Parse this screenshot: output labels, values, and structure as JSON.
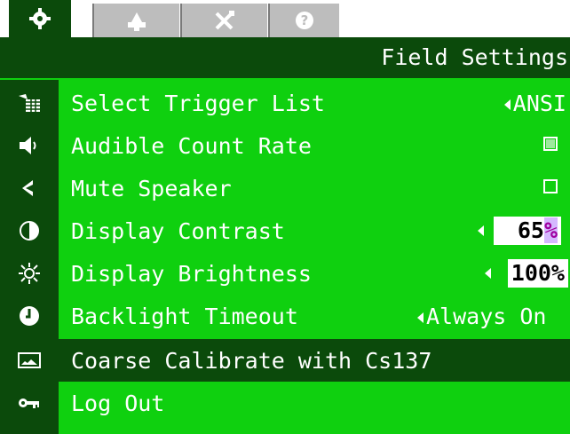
{
  "tabs": [
    {
      "name": "settings",
      "icon": "gear-icon",
      "active": true
    },
    {
      "name": "user",
      "icon": "person-icon",
      "active": false
    },
    {
      "name": "tools",
      "icon": "tools-icon",
      "active": false
    },
    {
      "name": "help",
      "icon": "help-icon",
      "active": false
    }
  ],
  "header": {
    "title": "Field Settings"
  },
  "menu": [
    {
      "icon": "trigger-list-icon",
      "label": "Select Trigger List",
      "value": "ANSI",
      "control": "arrow-select"
    },
    {
      "icon": "speaker-icon",
      "label": "Audible Count Rate",
      "checked": true,
      "control": "checkbox"
    },
    {
      "icon": "mute-icon",
      "label": "Mute Speaker",
      "checked": false,
      "control": "checkbox"
    },
    {
      "icon": "contrast-icon",
      "label": "Display Contrast",
      "value": "65%",
      "value_number": "65",
      "value_unit": "%",
      "control": "spinner"
    },
    {
      "icon": "brightness-icon",
      "label": "Display Brightness",
      "value": "100%",
      "control": "spinner"
    },
    {
      "icon": "timer-icon",
      "label": "Backlight Timeout",
      "value": "Always On",
      "control": "arrow-select"
    },
    {
      "icon": "calibrate-icon",
      "label": "Coarse Calibrate with Cs137",
      "selected": true,
      "control": "action"
    },
    {
      "icon": "key-icon",
      "label": "Log Out",
      "control": "action"
    }
  ],
  "colors": {
    "background": "#0fd00f",
    "dark": "#0b4a0b",
    "text": "#ffffff"
  }
}
